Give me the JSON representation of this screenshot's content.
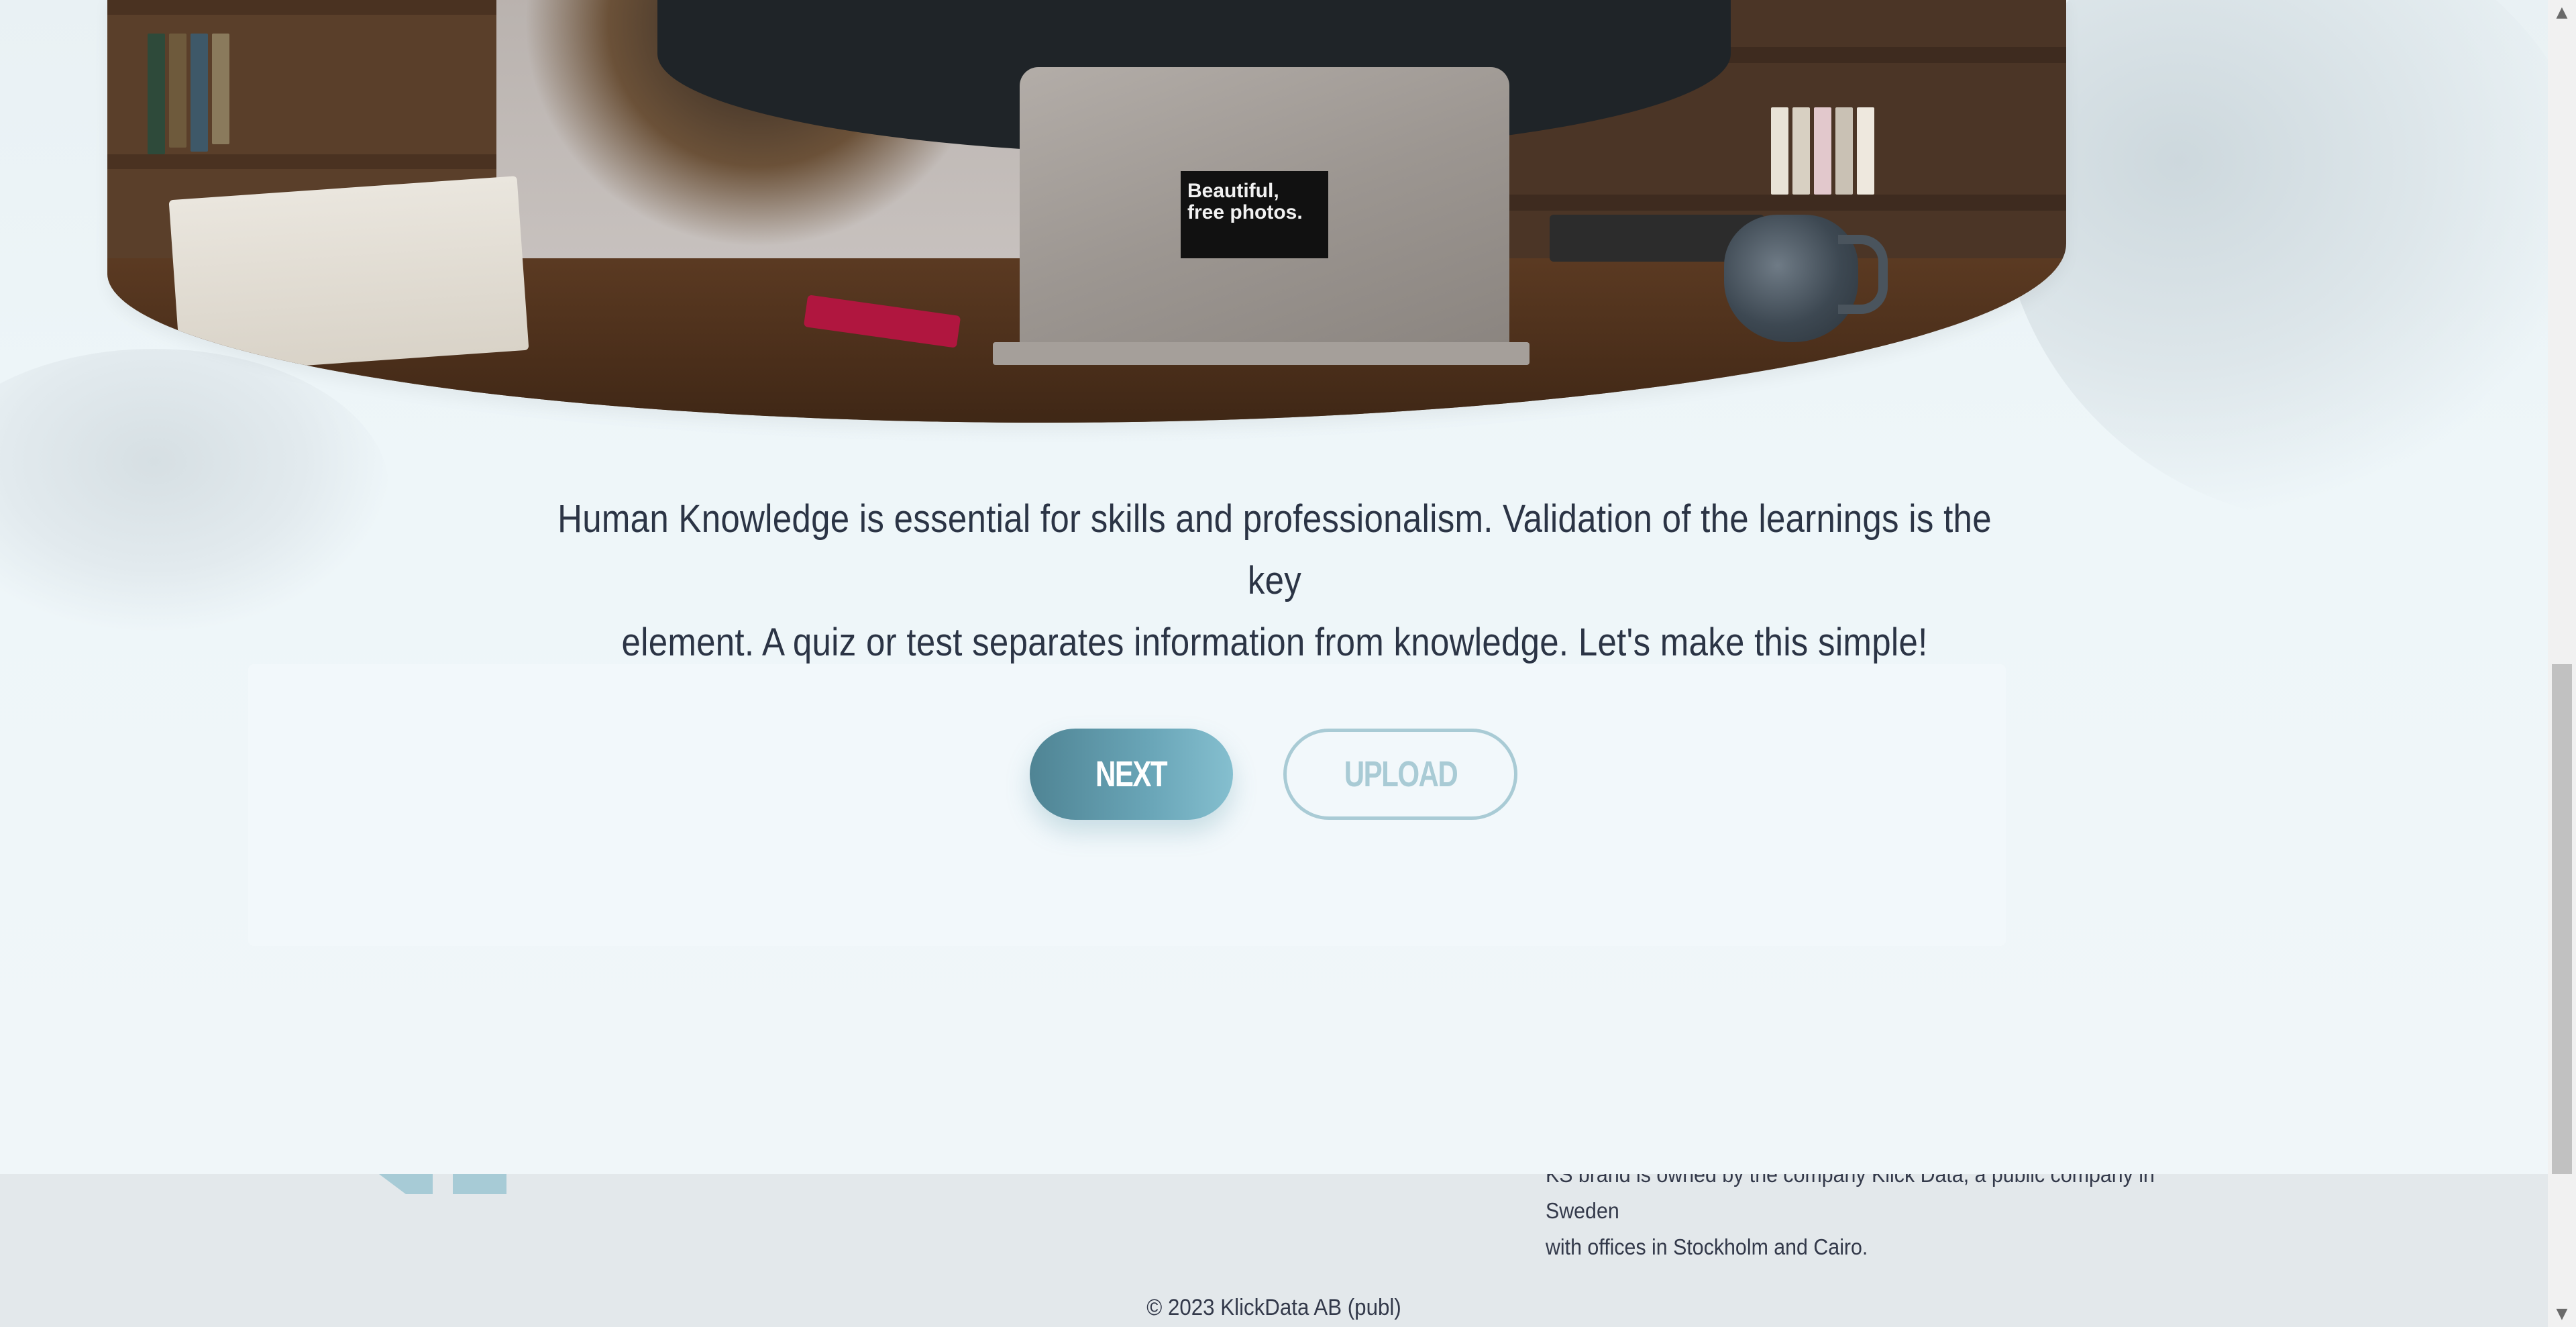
{
  "intro": {
    "line1": "Human Knowledge is essential for skills and professionalism. Validation of the learnings is the key",
    "line2": "element. A quiz or test separates information from knowledge. Let's make this simple!"
  },
  "buttons": {
    "next_label": "NEXT",
    "upload_label": "UPLOAD"
  },
  "hero": {
    "sticker_line1": "Beautiful,",
    "sticker_line2": "free photos."
  },
  "footer": {
    "about_line1": "KS brand is owned by the company Klick Data, a public company in Sweden",
    "about_line2": "with offices in Stockholm and Cairo.",
    "copyright": "© 2023 KlickData AB (publ)"
  },
  "colors": {
    "accent": "#6aa6b8",
    "upload_outline": "#a9cbd5",
    "text": "#2b3445",
    "footer_bg": "#e3e8eb"
  },
  "icons": {
    "scroll_up": "scroll-up-arrow-icon",
    "scroll_down": "scroll-down-arrow-icon"
  }
}
